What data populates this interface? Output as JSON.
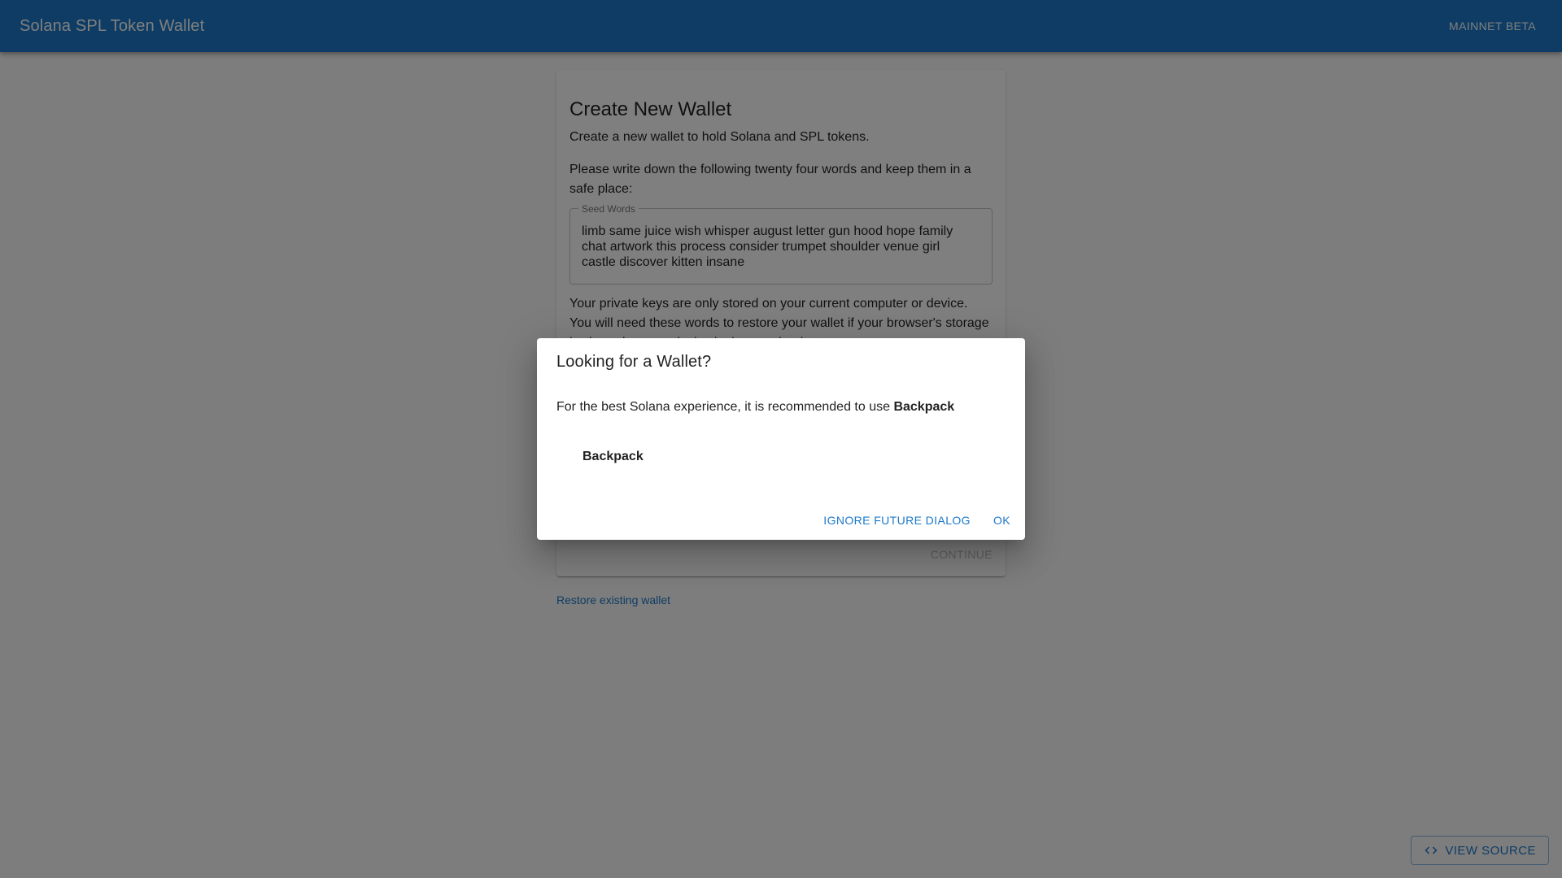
{
  "appbar": {
    "title": "Solana SPL Token Wallet",
    "network_label": "MAINNET BETA"
  },
  "card": {
    "title": "Create New Wallet",
    "subtitle": "Create a new wallet to hold Solana and SPL tokens.",
    "instructions": "Please write down the following twenty four words and keep them in a safe place:",
    "seed_label": "Seed Words",
    "seed_words": "limb same juice wish whisper august letter gun hood hope family chat artwork this process consider trumpet shoulder venue girl castle discover kitten insane",
    "privacy_text": "Your private keys are only stored on your current computer or device. You will need these words to restore your wallet if your browser's storage is cleared or your device is damaged or lost.",
    "continue_label": "CONTINUE"
  },
  "restore_link": "Restore existing wallet",
  "view_source": {
    "label": "VIEW SOURCE",
    "icon": "code-icon"
  },
  "dialog": {
    "title": "Looking for a Wallet?",
    "body_prefix": "For the best Solana experience, it is recommended to use ",
    "body_highlight": "Backpack",
    "option_label": "Backpack",
    "ignore_label": "IGNORE FUTURE DIALOG",
    "ok_label": "OK"
  },
  "colors": {
    "primary": "#1c79c9",
    "backdrop": "rgba(0,0,0,0.5)"
  }
}
